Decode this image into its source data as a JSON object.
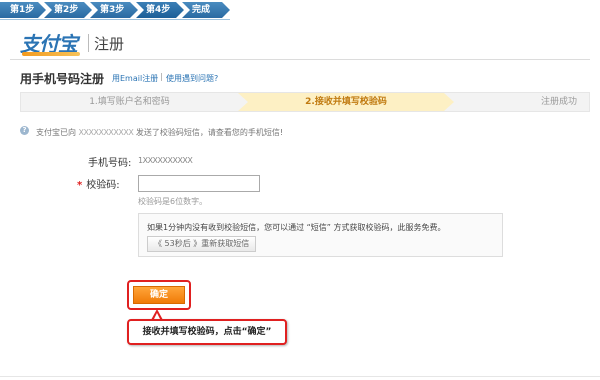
{
  "steps": [
    {
      "label": "第1步"
    },
    {
      "label": "第2步"
    },
    {
      "label": "第3步"
    },
    {
      "label": "第4步"
    },
    {
      "label": "完成"
    }
  ],
  "header": {
    "logo_text": "支付宝",
    "title": "注册"
  },
  "subtitle": {
    "title": "用手机号码注册",
    "link_email": "用Email注册",
    "separator": "|",
    "link_problem": "使用遇到问题?"
  },
  "progress": {
    "items": [
      {
        "label": "1.填写账户名和密码"
      },
      {
        "label": "2.接收并填写校验码"
      },
      {
        "label": "注册成功"
      }
    ],
    "active_index": 1
  },
  "notice": {
    "prefix": "支付宝已向",
    "masked_phone": "XXXXXXXXXXX",
    "suffix": "发送了校验码短信，请查看您的手机短信!"
  },
  "form": {
    "phone_label": "手机号码:",
    "phone_value": "1XXXXXXXXXX",
    "required_mark": "*",
    "code_label": "校验码:",
    "code_value": "",
    "code_hint": "校验码是6位数字。",
    "info_text": "如果1分钟内没有收到校验短信，您可以通过 “短信” 方式获取校验码，此服务免费。",
    "resend_label": "《 53秒后 》重新获取短信"
  },
  "actions": {
    "confirm_label": "确定"
  },
  "callout": {
    "text": "接收并填写校验码，点击“确定”"
  },
  "colors": {
    "accent_blue": "#2b74b4",
    "confirm_orange": "#f07b08",
    "highlight_red": "#e02020",
    "progress_active": "#fdf0c4"
  }
}
